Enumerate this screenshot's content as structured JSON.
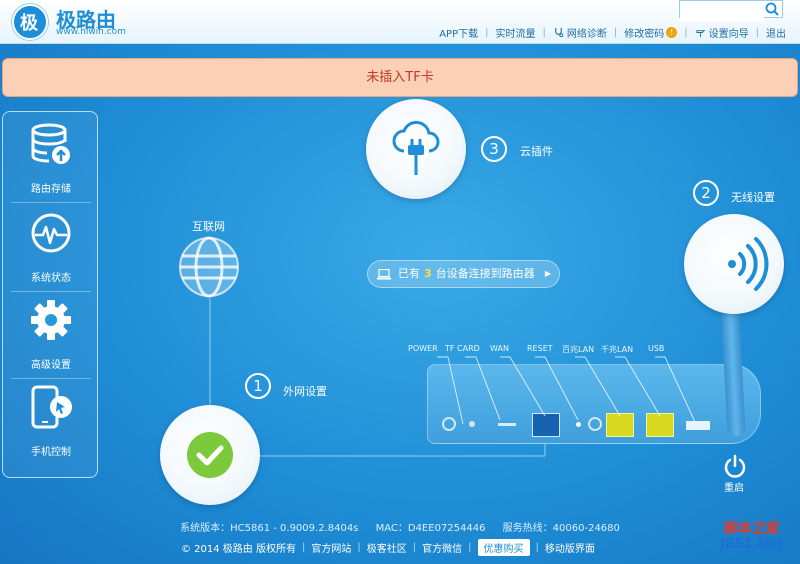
{
  "brand": {
    "name": "极路由",
    "url": "www.hiwifi.com"
  },
  "search": {
    "placeholder": ""
  },
  "topnav": {
    "app_download": "APP下载",
    "realtime_traffic": "实时流量",
    "network_diagnosis": "网络诊断",
    "change_password": "修改密码",
    "setup_wizard": "设置向导",
    "logout": "退出",
    "warning_mark": "!"
  },
  "alert": {
    "text": "未插入TF卡"
  },
  "sidebar": {
    "items": [
      {
        "label": "路由存储",
        "icon": "storage-icon"
      },
      {
        "label": "系统状态",
        "icon": "status-icon"
      },
      {
        "label": "高级设置",
        "icon": "gear-icon"
      },
      {
        "label": "手机控制",
        "icon": "phone-icon"
      }
    ]
  },
  "diagram": {
    "internet_label": "互联网",
    "step1": {
      "number": "1",
      "label": "外网设置"
    },
    "step2": {
      "number": "2",
      "label": "无线设置"
    },
    "step3": {
      "number": "3",
      "label": "云插件"
    },
    "devices": {
      "prefix": "已有",
      "count": "3",
      "suffix": "台设备连接到路由器"
    },
    "reboot_label": "重启"
  },
  "router_ports": [
    "POWER",
    "TF CARD",
    "WAN",
    "RESET",
    "百兆LAN",
    "千兆LAN",
    "USB"
  ],
  "footer": {
    "system_version": "系统版本：HC5861 - 0.9009.2.8404s",
    "mac": "MAC：D4EE07254446",
    "hotline": "服务热线：40060-24680",
    "copyright": "© 2014 极路由 版权所有",
    "official_site": "官方网站",
    "blog": "极客社区",
    "wechat": "官方微信",
    "promo": "优惠购买",
    "mobile": "移动版界面"
  },
  "watermark": {
    "line1": "脚本之家",
    "line2": "JB51.Net"
  },
  "colors": {
    "accent": "#1f8ed6",
    "alert_bg": "#fbd0b6",
    "alert_text": "#c0392b",
    "ok_green": "#7cc93b",
    "port_yellow": "#d8d81f"
  }
}
